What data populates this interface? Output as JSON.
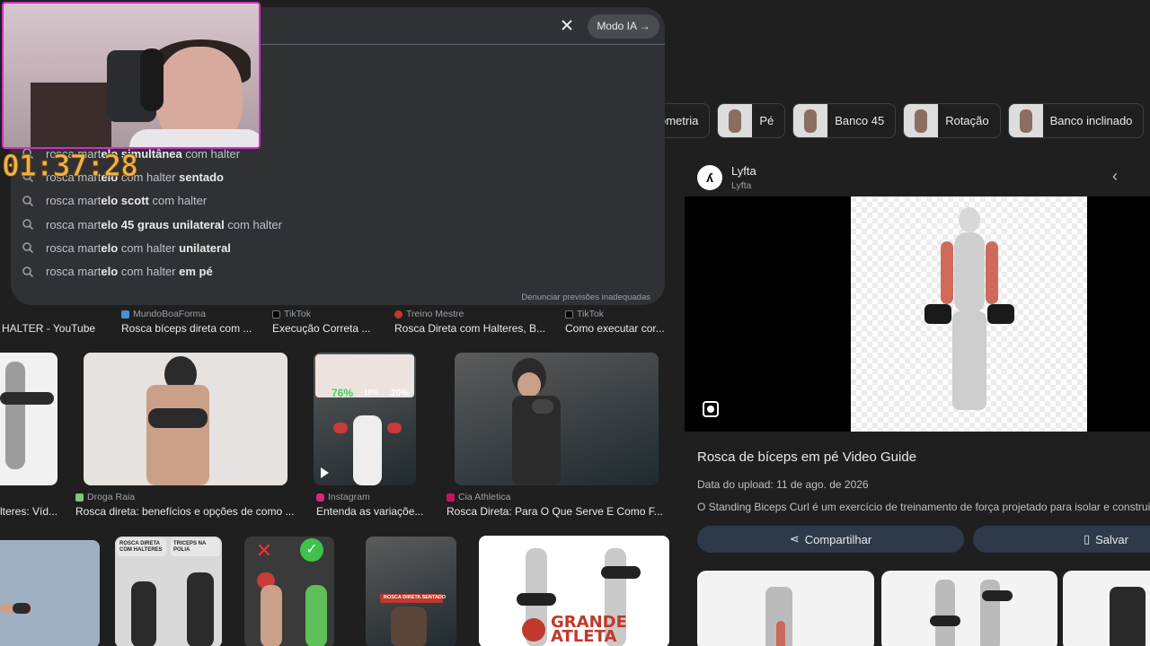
{
  "search": {
    "ai_mode_label": "Modo IA",
    "suggestions": [
      [
        {
          "t": "rosca mart",
          "b": false
        },
        {
          "t": "elo simultânea",
          "b": true
        },
        {
          "t": " com halter",
          "b": false
        }
      ],
      [
        {
          "t": "rosca mart",
          "b": false
        },
        {
          "t": "elo",
          "b": true
        },
        {
          "t": " com halter ",
          "b": false
        },
        {
          "t": "sentado",
          "b": true
        }
      ],
      [
        {
          "t": "rosca mart",
          "b": false
        },
        {
          "t": "elo scott",
          "b": true
        },
        {
          "t": " com halter",
          "b": false
        }
      ],
      [
        {
          "t": "rosca mart",
          "b": false
        },
        {
          "t": "elo 45 graus unilateral",
          "b": true
        },
        {
          "t": " com halter",
          "b": false
        }
      ],
      [
        {
          "t": "rosca mart",
          "b": false
        },
        {
          "t": "elo",
          "b": true
        },
        {
          "t": " com halter ",
          "b": false
        },
        {
          "t": "unilateral",
          "b": true
        }
      ],
      [
        {
          "t": "rosca mart",
          "b": false
        },
        {
          "t": "elo",
          "b": true
        },
        {
          "t": " com halter ",
          "b": false
        },
        {
          "t": "em pé",
          "b": true
        }
      ]
    ],
    "report_label": "Denunciar previsões inadequadas"
  },
  "overlay": {
    "timer": "01:37:28"
  },
  "chips": [
    "ometria",
    "Pé",
    "Banco 45",
    "Rotação",
    "Banco inclinado"
  ],
  "results": {
    "row1": [
      {
        "source": "",
        "caption": "HALTER - YouTube"
      },
      {
        "source": "MundoBoaForma",
        "caption": "Rosca bíceps direta com ..."
      },
      {
        "source": "TikTok",
        "caption": "Execução Correta ..."
      },
      {
        "source": "Treino Mestre",
        "caption": "Rosca Direta com Halteres, B..."
      },
      {
        "source": "TikTok",
        "caption": "Como executar cor..."
      }
    ],
    "row2": [
      {
        "source": "",
        "caption": "lteres: Víd..."
      },
      {
        "source": "Droga Raia",
        "caption": "Rosca direta: benefícios e opções de como ..."
      },
      {
        "source": "Instagram",
        "caption": "Entenda as variaçõe..."
      },
      {
        "source": "Cia Athletica",
        "caption": "Rosca Direta: Para O Que Serve E Como F..."
      }
    ],
    "thumb_text": {
      "pct_a": "76%",
      "pct_b": "16%",
      "pct_c": "20%",
      "tag_a": "ROSCA DIRETA COM HALTERES",
      "tag_b": "TRICEPS NA POLIA",
      "tag_c": "ROSCA DIRETA SENTADO",
      "brand_a": "GRANDE",
      "brand_b": "ATLETA"
    }
  },
  "panel": {
    "logo_glyph": "ʎ",
    "site_name": "Lyfta",
    "site_sub": "Lyfta",
    "title": "Rosca de bíceps em pé Video Guide",
    "date": "Data do upload: 11 de ago. de 2026",
    "description": "O Standing Biceps Curl é um exercício de treinamento de força projetado para isolar e construir os",
    "share_label": "Compartilhar",
    "save_label": "Salvar"
  },
  "colors": {
    "accent_border": "#d12ec8",
    "timer": "#e9b649",
    "panel_button": "#2e3a4a"
  }
}
